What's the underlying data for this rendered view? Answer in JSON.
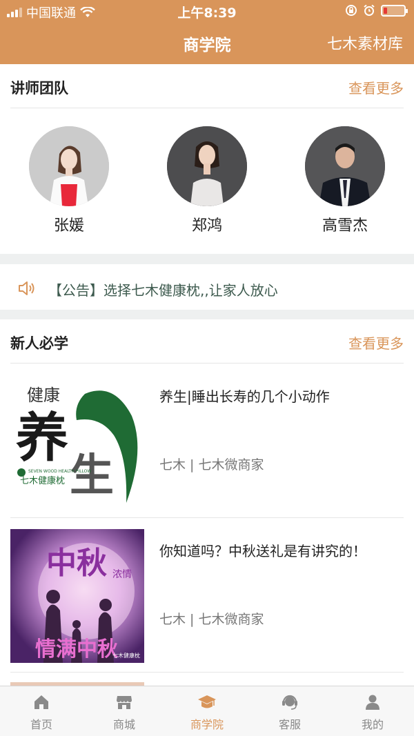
{
  "status": {
    "carrier": "中国联通",
    "time": "上午8:39"
  },
  "nav": {
    "title": "商学院",
    "right_link": "七木素材库"
  },
  "teachers_section": {
    "title": "讲师团队",
    "more": "查看更多",
    "items": [
      {
        "name": "张媛"
      },
      {
        "name": "郑鸿"
      },
      {
        "name": "高雪杰"
      }
    ]
  },
  "notice": {
    "text": "【公告】选择七木健康枕,,让家人放心"
  },
  "newbie_section": {
    "title": "新人必学",
    "more": "查看更多",
    "articles": [
      {
        "title": "养生|睡出长寿的几个小动作",
        "meta": "七木 | 七木微商家",
        "thumb": {
          "line1": "健康",
          "big1": "养",
          "big2": "生",
          "brand_en": "SEVEN WOOD HEALTH PILLOW",
          "brand_cn": "七木健康枕"
        }
      },
      {
        "title": "你知道吗？中秋送礼是有讲究的！",
        "meta": "七木 | 七木微商家",
        "thumb": {
          "big": "中秋",
          "sub": "浓情",
          "bottom": "情满中秋",
          "brand": "七木健康枕"
        }
      }
    ]
  },
  "tabbar": {
    "items": [
      {
        "label": "首页",
        "icon": "home-icon"
      },
      {
        "label": "商城",
        "icon": "store-icon"
      },
      {
        "label": "商学院",
        "icon": "graduation-cap-icon"
      },
      {
        "label": "客服",
        "icon": "customer-service-icon"
      },
      {
        "label": "我的",
        "icon": "user-icon"
      }
    ],
    "active_index": 2
  },
  "colors": {
    "accent": "#d9955a",
    "notice_text": "#3d5a4e",
    "low_battery": "#e53935"
  }
}
